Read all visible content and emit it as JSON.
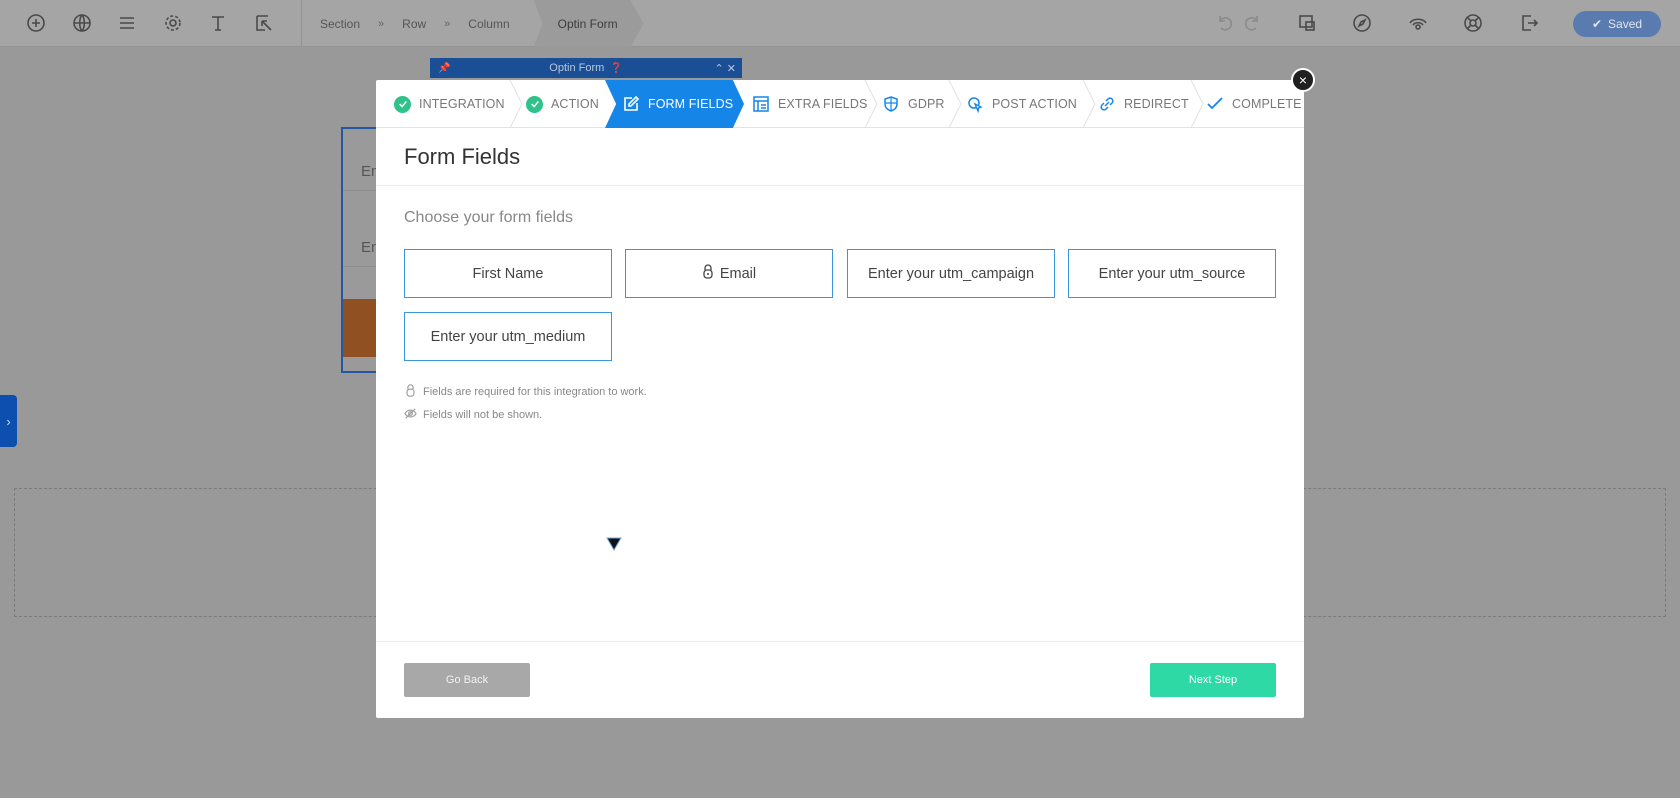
{
  "toolbar": {
    "icons": [
      "add-icon",
      "globe-icon",
      "layers-icon",
      "settings-icon",
      "text-icon",
      "cursor-select-icon",
      "undo-icon",
      "redo-icon",
      "layout-icon",
      "compass-icon",
      "preview-icon",
      "help-icon",
      "exit-icon"
    ],
    "breadcrumbs": [
      "Section",
      "Row",
      "Column"
    ],
    "breadcrumb_separator": "»",
    "active_crumb": "Optin Form",
    "saved_label": "Saved"
  },
  "canvas": {
    "optin_bar_label": "Optin Form",
    "bg_row_text": "En",
    "side_tab_glyph": "›"
  },
  "wizard": {
    "steps": [
      {
        "label": "INTEGRATION",
        "state": "done",
        "icon": "check-circle-icon"
      },
      {
        "label": "ACTION",
        "state": "done",
        "icon": "check-circle-icon"
      },
      {
        "label": "FORM FIELDS",
        "state": "active",
        "icon": "edit-icon"
      },
      {
        "label": "EXTRA FIELDS",
        "state": "pending",
        "icon": "extra-fields-icon"
      },
      {
        "label": "GDPR",
        "state": "pending",
        "icon": "shield-icon"
      },
      {
        "label": "POST ACTION",
        "state": "pending",
        "icon": "pointer-icon"
      },
      {
        "label": "REDIRECT",
        "state": "pending",
        "icon": "link-icon"
      },
      {
        "label": "COMPLETE",
        "state": "pending",
        "icon": "checkmark-icon"
      }
    ],
    "title": "Form Fields",
    "subtitle": "Choose your form fields",
    "fields": [
      {
        "label": "First Name",
        "required": false
      },
      {
        "label": "Email",
        "required": true
      },
      {
        "label": "Enter your utm_campaign",
        "required": false
      },
      {
        "label": "Enter your utm_source",
        "required": false
      },
      {
        "label": "Enter your utm_medium",
        "required": false
      }
    ],
    "notes": {
      "required": "Fields are required for this integration to work.",
      "hidden": "Fields will not be shown."
    },
    "back_label": "Go Back",
    "next_label": "Next Step",
    "close_glyph": "×"
  },
  "colors": {
    "accent": "#1586e8",
    "done": "#2fc28a",
    "next_button": "#2ed9a5",
    "field_border": "#3c96dd"
  }
}
